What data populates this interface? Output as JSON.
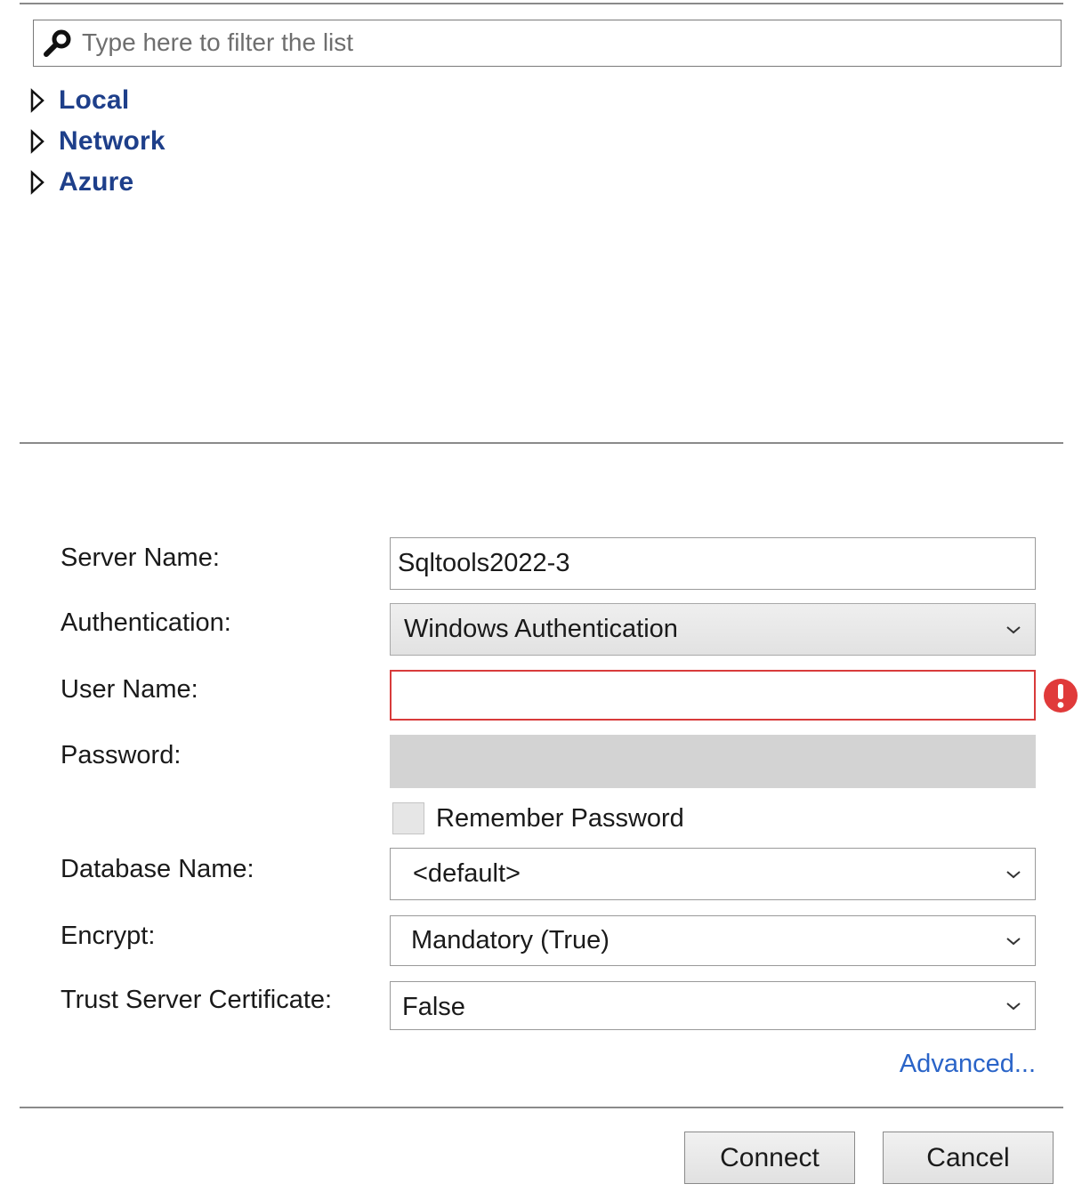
{
  "filter": {
    "placeholder": "Type here to filter the list",
    "icon": "search-icon"
  },
  "tree": {
    "items": [
      {
        "label": "Local",
        "icon": "expand-arrow-icon"
      },
      {
        "label": "Network",
        "icon": "expand-arrow-icon"
      },
      {
        "label": "Azure",
        "icon": "expand-arrow-icon"
      }
    ]
  },
  "form": {
    "server_name": {
      "label": "Server Name:",
      "value": "Sqltools2022-3"
    },
    "authentication": {
      "label": "Authentication:",
      "value": "Windows Authentication"
    },
    "user_name": {
      "label": "User Name:",
      "value": "",
      "error_icon": "error-icon"
    },
    "password": {
      "label": "Password:",
      "value": ""
    },
    "remember_password": {
      "label": "Remember Password",
      "checked": false
    },
    "database_name": {
      "label": "Database Name:",
      "value": "<default>"
    },
    "encrypt": {
      "label": "Encrypt:",
      "value": "Mandatory (True)"
    },
    "trust_server_certificate": {
      "label": "Trust Server Certificate:",
      "value": "False"
    },
    "advanced_link": "Advanced..."
  },
  "buttons": {
    "connect": "Connect",
    "cancel": "Cancel"
  },
  "colors": {
    "tree_label": "#1e3f8a",
    "link": "#2a64c8",
    "error": "#e03a3a"
  }
}
